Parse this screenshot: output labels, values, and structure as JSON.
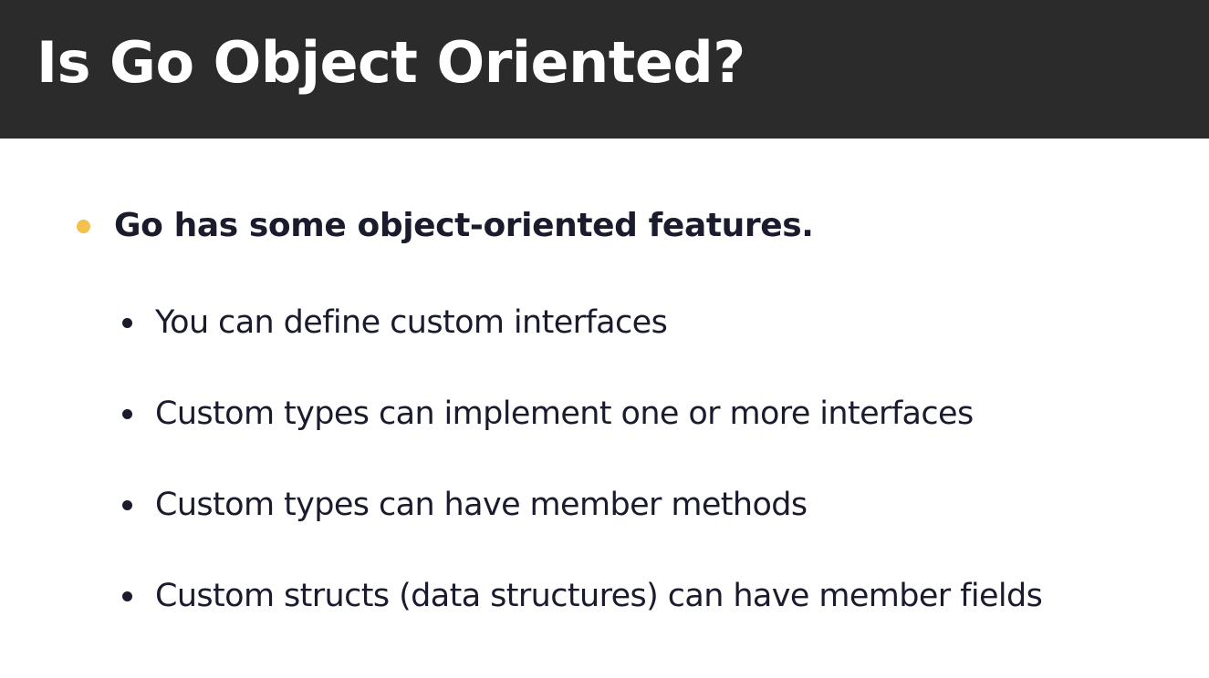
{
  "slide": {
    "title": "Is Go Object Oriented?",
    "main_bullet": {
      "text": "Go has some object-oriented features.",
      "bullet_color": "#f2c14e"
    },
    "sub_bullets": [
      "You can define custom interfaces",
      "Custom types can implement one or more interfaces",
      "Custom types can have member methods",
      "Custom structs (data structures) can have member fields"
    ]
  },
  "colors": {
    "header_background": "#2b2b2b",
    "title_text": "#ffffff",
    "body_text": "#1a1c2e",
    "page_background": "#ffffff"
  }
}
